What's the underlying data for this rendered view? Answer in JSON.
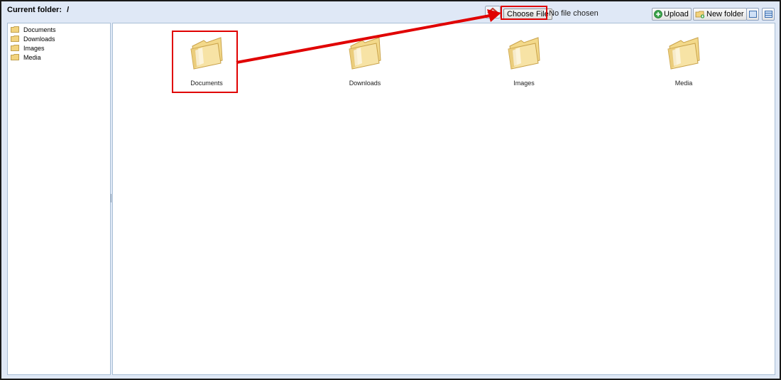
{
  "header": {
    "current_folder_label": "Current folder:",
    "current_folder_path": "/"
  },
  "toolbar": {
    "choose_file_label": "Choose File",
    "no_file_text": "No file chosen",
    "upload_label": "Upload",
    "new_folder_label": "New folder"
  },
  "sidebar": {
    "items": [
      {
        "label": "Documents"
      },
      {
        "label": "Downloads"
      },
      {
        "label": "Images"
      },
      {
        "label": "Media"
      }
    ]
  },
  "main": {
    "folders": [
      {
        "label": "Documents"
      },
      {
        "label": "Downloads"
      },
      {
        "label": "Images"
      },
      {
        "label": "Media"
      }
    ]
  },
  "icons": {
    "home": "home-icon",
    "upload": "upload-icon",
    "new_folder": "new-folder-icon",
    "folder": "folder-icon",
    "view_thumbnails": "thumbnail-view-icon",
    "view_list": "list-view-icon"
  },
  "colors": {
    "annotation": "#e00000",
    "folder": "#f2d37e",
    "background": "#dfe8f6",
    "panel_border": "#a9bfd6"
  }
}
